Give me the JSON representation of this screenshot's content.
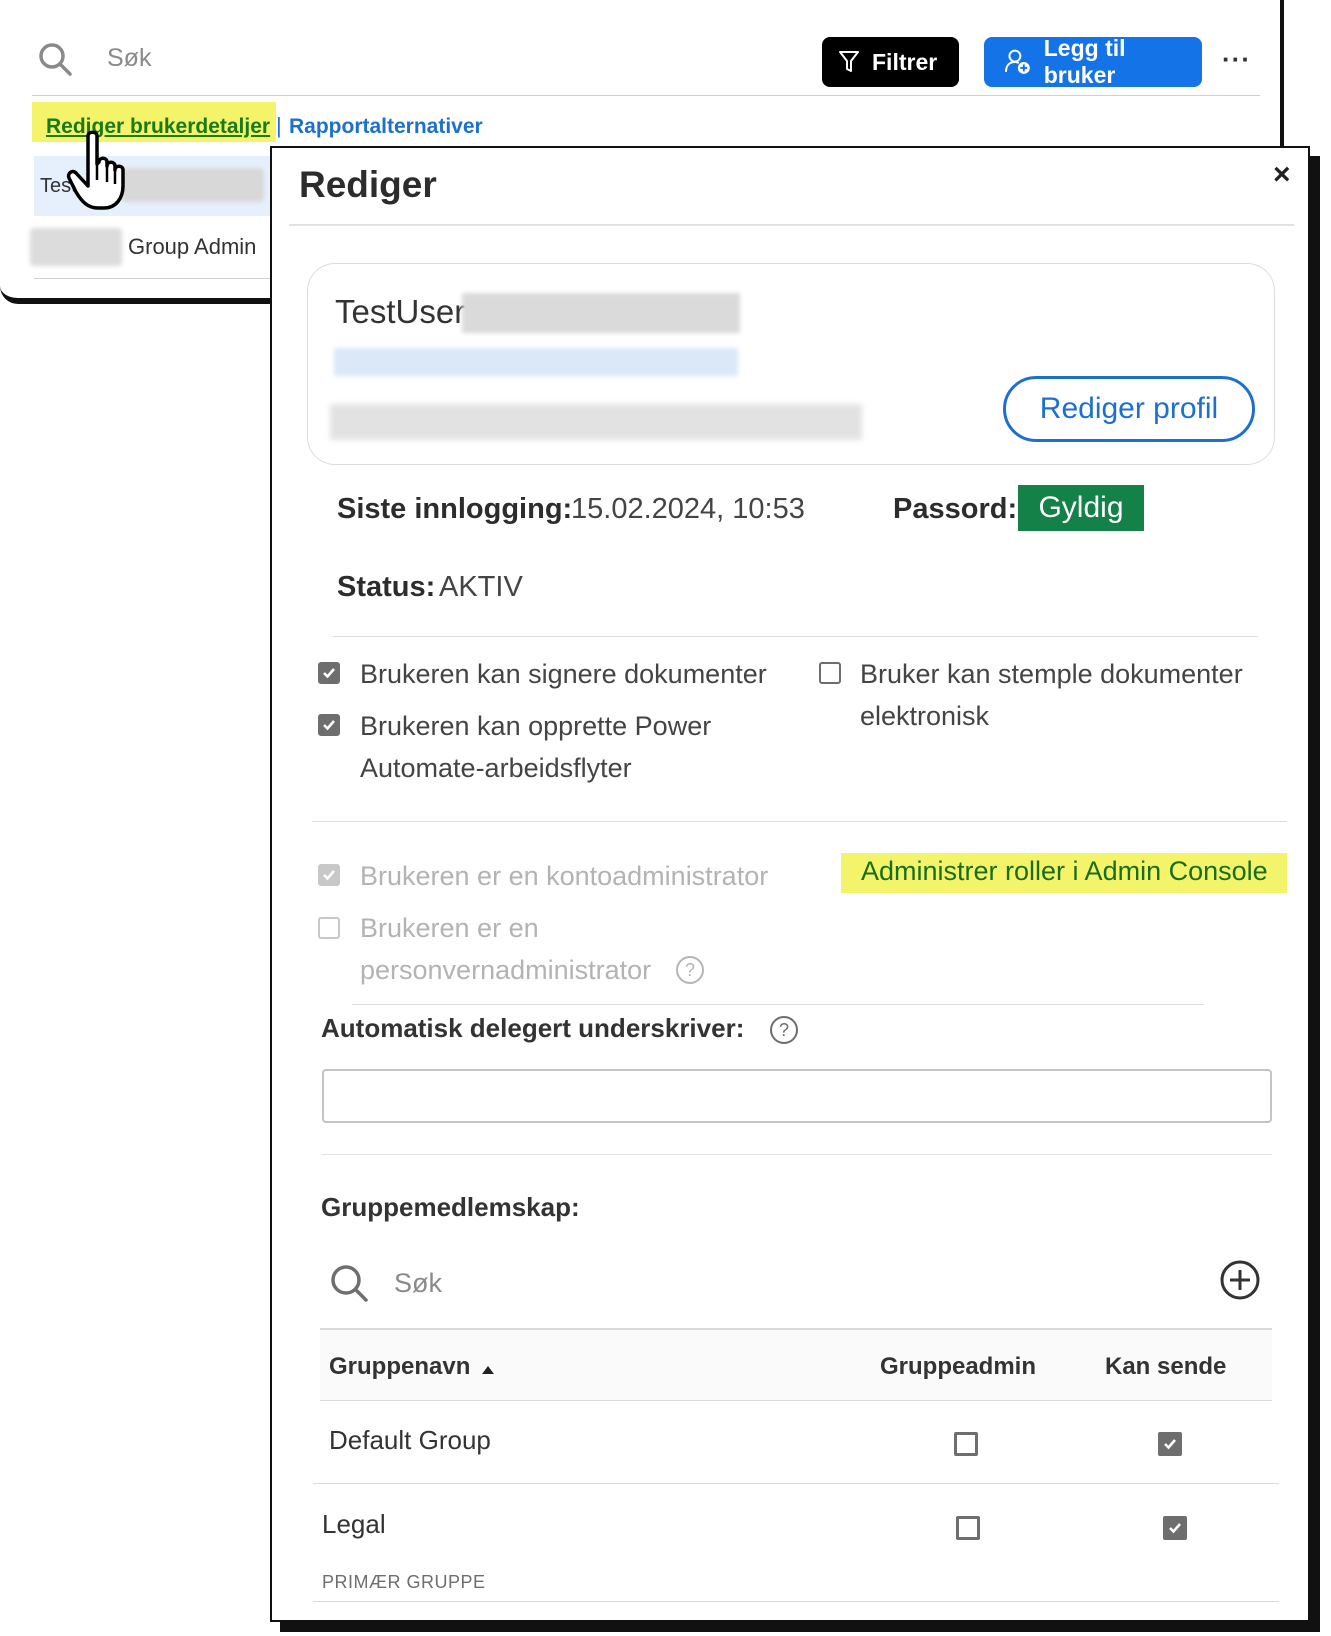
{
  "list": {
    "search_placeholder": "Søk",
    "filter_label": "Filtrer",
    "add_user_label": "Legg til bruker",
    "more_label": "···",
    "edit_details_link": "Rediger brukerdetaljer",
    "separator": "|",
    "report_options_link": "Rapportalternativer",
    "row1_name": "Test",
    "row2_role": "Group Admin"
  },
  "modal": {
    "title": "Rediger",
    "close_label": "×",
    "profile": {
      "name": "TestUser",
      "edit_profile_label": "Rediger profil"
    },
    "last_login_label": "Siste innlogging:",
    "last_login_value": "15.02.2024, 10:53",
    "password_label": "Passord:",
    "password_value": "Gyldig",
    "status_label": "Status:",
    "status_value": "AKTIV",
    "options": {
      "sign": {
        "label": "Brukeren kan signere dokumenter",
        "checked": true
      },
      "stamp": {
        "label": "Bruker kan stemple dokumenter elektronisk",
        "checked": false
      },
      "power": {
        "label": "Brukeren kan opprette Power Automate-arbeidsflyter",
        "checked": true
      }
    },
    "roles": {
      "account_admin": {
        "label": "Brukeren er en kontoadministrator",
        "checked": true,
        "disabled": true
      },
      "privacy_admin": {
        "label": "Brukeren er en personvernadministrator",
        "checked": false,
        "disabled": true
      },
      "admin_console_link": "Administrer roller i Admin Console",
      "help_glyph": "?"
    },
    "delegate_label": "Automatisk delegert underskriver:",
    "delegate_value": "",
    "group_membership": {
      "label": "Gruppemedlemskap:",
      "search_placeholder": "Søk",
      "columns": {
        "name": "Gruppenavn",
        "admin": "Gruppeadmin",
        "send": "Kan sende"
      },
      "rows": [
        {
          "name": "Default Group",
          "group_admin": false,
          "can_send": true,
          "sub": ""
        },
        {
          "name": "Legal",
          "group_admin": false,
          "can_send": true,
          "sub": "PRIMÆR GRUPPE"
        }
      ]
    }
  },
  "colors": {
    "accent_blue": "#1473e6",
    "link_blue": "#1d6fd0",
    "valid_green": "#148148",
    "highlight_yellow": "#f4f46a"
  },
  "icons": [
    "search-icon",
    "filter-icon",
    "add-user-icon",
    "more-icon",
    "hand-cursor-icon",
    "close-icon",
    "checkmark-icon",
    "help-icon",
    "add-circle-icon",
    "sort-ascending-icon"
  ]
}
